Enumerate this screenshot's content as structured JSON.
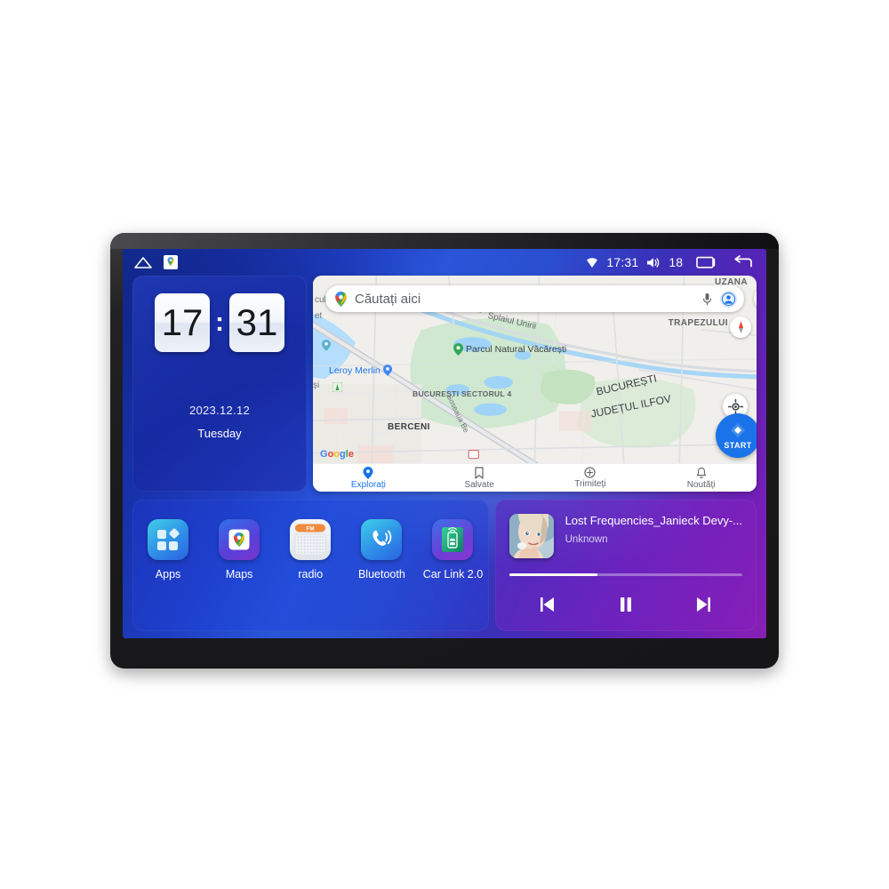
{
  "statusbar": {
    "home_icon": "home-icon",
    "maps_icon": "google-maps-icon",
    "wifi_icon": "wifi-icon",
    "time": "17:31",
    "volume_icon": "volume-icon",
    "volume_value": "18",
    "recents_icon": "recents-icon",
    "back_icon": "back-icon"
  },
  "clock_widget": {
    "hours": "17",
    "separator": ":",
    "minutes": "31",
    "date": "2023.12.12",
    "weekday": "Tuesday"
  },
  "map_widget": {
    "search": {
      "placeholder": "Căutați aici",
      "pin_icon": "google-maps-pin-icon",
      "mic_icon": "microphone-icon",
      "account_icon": "account-avatar-icon"
    },
    "layers_icon": "layers-icon",
    "compass_icon": "compass-icon",
    "my_location_icon": "my-location-icon",
    "start_button_label": "START",
    "start_button_icon": "navigation-arrow-icon",
    "watermark": "Google",
    "labels": [
      "UZANA",
      "TRAPEZULUI",
      "Splaiul Unirii",
      "Unirii",
      "Parcul Natural Văcărești",
      "Leroy Merlin",
      "BUCUREȘTI",
      "JUDEȚUL ILFOV",
      "BUCUREȘTI SECTORUL 4",
      "BERCENI",
      "Soseaua Be",
      "cul",
      "et",
      "și"
    ],
    "nav": [
      {
        "label": "Explorați",
        "icon": "location-pin-icon",
        "active": true
      },
      {
        "label": "Salvate",
        "icon": "bookmark-icon",
        "active": false
      },
      {
        "label": "Trimiteți",
        "icon": "contribute-icon",
        "active": false
      },
      {
        "label": "Noutăți",
        "icon": "bell-icon",
        "active": false
      }
    ]
  },
  "dock": {
    "apps": [
      {
        "label": "Apps",
        "icon": "apps-grid-icon"
      },
      {
        "label": "Maps",
        "icon": "google-maps-icon"
      },
      {
        "label": "radio",
        "icon": "fm-radio-icon",
        "badge": "FM"
      },
      {
        "label": "Bluetooth",
        "icon": "phone-call-icon"
      },
      {
        "label": "Car Link 2.0",
        "icon": "car-link-icon"
      }
    ]
  },
  "music_player": {
    "album_art": "album-art-portrait",
    "title": "Lost Frequencies_Janieck Devy-...",
    "artist": "Unknown",
    "progress_percent": 38,
    "controls": [
      {
        "name": "previous-button",
        "icon": "skip-previous-icon"
      },
      {
        "name": "play-pause-button",
        "icon": "pause-icon"
      },
      {
        "name": "next-button",
        "icon": "skip-next-icon"
      }
    ]
  },
  "colors": {
    "accent_blue": "#1a73e8",
    "screen_blue": "#1f3fc4",
    "screen_purple": "#8a1fb5",
    "music_card": "#7a28c3"
  }
}
